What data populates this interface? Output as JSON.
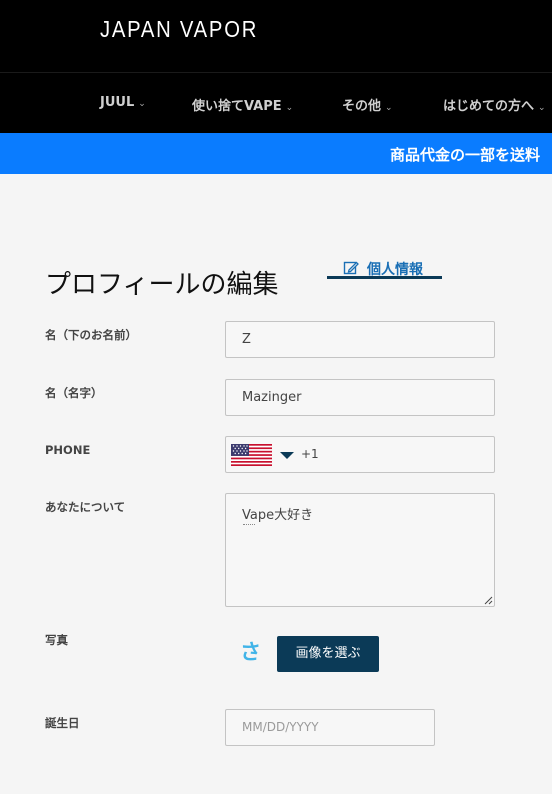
{
  "header": {
    "logo": "JAPAN VAPOR"
  },
  "nav": {
    "items": [
      {
        "label": "JUUL"
      },
      {
        "label": "使い捨てVAPE"
      },
      {
        "label": "その他"
      },
      {
        "label": "はじめての方へ"
      }
    ]
  },
  "banner": {
    "text": "商品代金の一部を送料"
  },
  "page": {
    "title": "プロフィールの編集",
    "personal_info_link": "個人情報"
  },
  "form": {
    "first_name": {
      "label": "名（下のお名前）",
      "value": "Z"
    },
    "last_name": {
      "label": "名（名字）",
      "value": "Mazinger"
    },
    "phone": {
      "label": "PHONE",
      "dial_code": "+1"
    },
    "about": {
      "label": "あなたについて",
      "value": "Vape大好き"
    },
    "photo": {
      "label": "写真",
      "initial": "さ",
      "button": "画像を選ぶ"
    },
    "birthday": {
      "label": "誕生日",
      "placeholder": "MM/DD/YYYY"
    }
  },
  "colors": {
    "header_bg": "#000000",
    "banner_bg": "#0a7cff",
    "accent_dark": "#0b3a57",
    "link": "#1a6fb5",
    "avatar_initial": "#41b4e8"
  }
}
